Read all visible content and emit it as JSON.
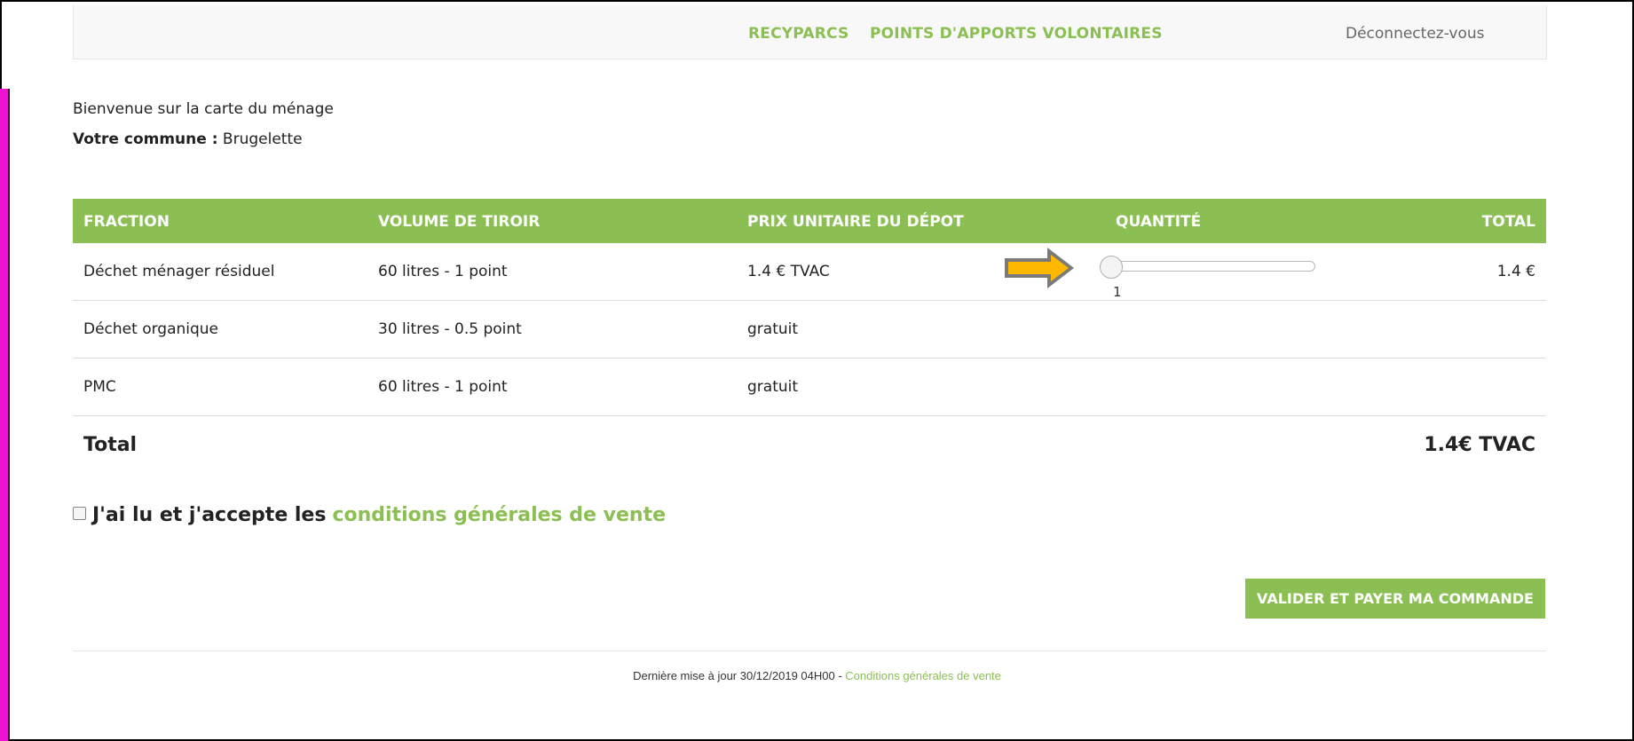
{
  "nav": {
    "links": [
      "RECYPARCS",
      "POINTS D'APPORTS VOLONTAIRES"
    ],
    "logout": "Déconnectez-vous"
  },
  "welcome": "Bienvenue sur la carte du ménage",
  "commune": {
    "label": "Votre commune :",
    "value": "Brugelette"
  },
  "table": {
    "headers": [
      "FRACTION",
      "VOLUME DE TIROIR",
      "PRIX UNITAIRE DU DÉPOT",
      "QUANTITÉ",
      "TOTAL"
    ],
    "rows": [
      {
        "fraction": "Déchet ménager résiduel",
        "volume": "60 litres - 1 point",
        "price": "1.4 € TVAC",
        "quantity": "1",
        "total": "1.4 €"
      },
      {
        "fraction": "Déchet organique",
        "volume": "30 litres - 0.5 point",
        "price": "gratuit",
        "quantity": "",
        "total": ""
      },
      {
        "fraction": "PMC",
        "volume": "60 litres - 1 point",
        "price": "gratuit",
        "quantity": "",
        "total": ""
      }
    ],
    "total_label": "Total",
    "total_value": "1.4€ TVAC"
  },
  "slider": {
    "value": 1,
    "min": 1,
    "max": 10,
    "value_label": "1"
  },
  "terms": {
    "text": "J'ai lu et j'accepte les",
    "link": "conditions générales de vente",
    "checked": false
  },
  "pay_button": "VALIDER ET PAYER MA COMMANDE",
  "footer": {
    "text": "Dernière mise à jour 30/12/2019 04H00 - ",
    "link": "Conditions générales de vente"
  },
  "colors": {
    "accent": "#8cbf53",
    "arrow": "#ffb800",
    "side_bar": "#ee12d2"
  },
  "icons": {
    "annotation_arrow": "right-arrow-icon",
    "checkbox": "checkbox-icon"
  }
}
